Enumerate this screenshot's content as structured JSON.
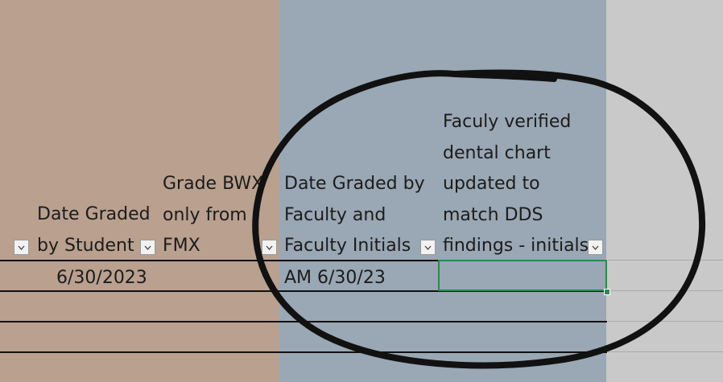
{
  "columns": [
    {
      "header": "",
      "color": "#b9a08f"
    },
    {
      "header": "Date Graded\nby Student",
      "color": "#b9a08f"
    },
    {
      "header": "Grade BWX\nonly from\nFMX",
      "color": "#b9a08f"
    },
    {
      "header": "Date Graded by\nFaculty and\nFaculty Initials",
      "color": "#9aa7b4"
    },
    {
      "header": "Faculy verified\ndental chart\nupdated to\nmatch DDS\nfindings - initials",
      "color": "#9aa7b4"
    },
    {
      "header": "",
      "color": "#c9c9c9"
    }
  ],
  "row1": {
    "date_graded_by_student": "6/30/2023",
    "grade_bwx": "",
    "date_graded_by_faculty": "AM 6/30/23",
    "faculty_verified": ""
  },
  "colors": {
    "tan_column": "#b9a08f",
    "blue_column": "#9aa7b4",
    "selection": "#2d8a4e",
    "annotation_ink": "#111111"
  },
  "icons": {
    "filter": "chevron-down-icon",
    "annotation": "hand-drawn-circle"
  }
}
